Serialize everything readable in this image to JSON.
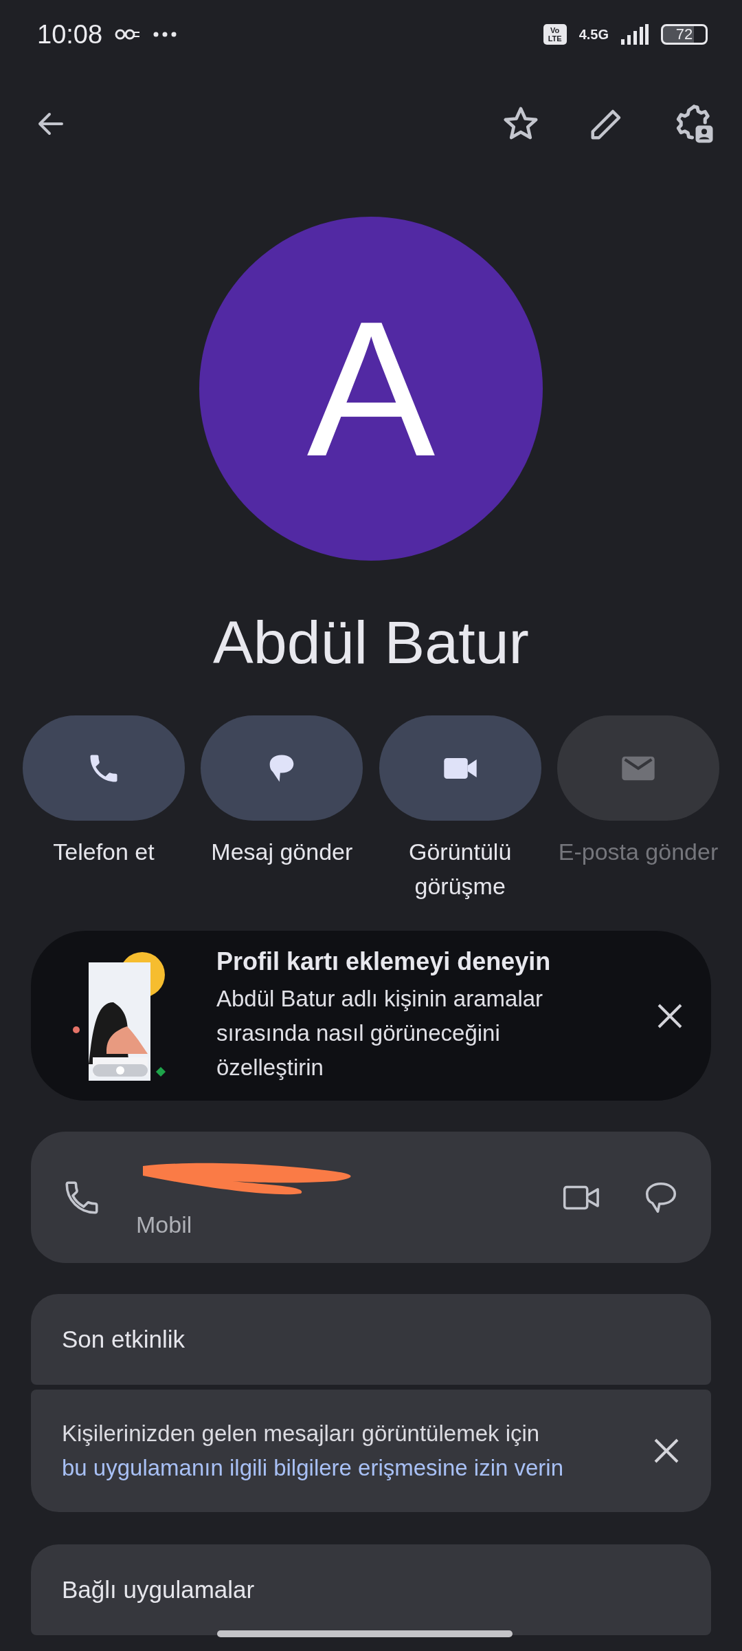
{
  "status_bar": {
    "time": "10:08",
    "volte_top": "Vo",
    "volte_bottom": "LTE",
    "network": "4.5G",
    "battery": "72"
  },
  "avatar": {
    "letter": "A",
    "color": "#5229a3"
  },
  "contact": {
    "name": "Abdül Batur"
  },
  "actions": [
    {
      "kind": "call",
      "label": "Telefon et",
      "disabled": false
    },
    {
      "kind": "message",
      "label": "Mesaj gönder",
      "disabled": false
    },
    {
      "kind": "video",
      "label": "Görüntülü görüşme",
      "disabled": false
    },
    {
      "kind": "email",
      "label": "E-posta gönder",
      "disabled": true
    }
  ],
  "promo": {
    "title": "Profil kartı eklemeyi deneyin",
    "text": "Abdül Batur adlı kişinin aramalar sırasında nasıl görüneceğini özelleştirin"
  },
  "phone": {
    "type": "Mobil"
  },
  "recent_activity": {
    "title": "Son etkinlik",
    "text": "Kişilerinizden gelen mesajları görüntülemek için",
    "link": "bu uygulamanın ilgili bilgilere erişmesine izin verin"
  },
  "connected_apps": {
    "title": "Bağlı uygulamalar"
  }
}
